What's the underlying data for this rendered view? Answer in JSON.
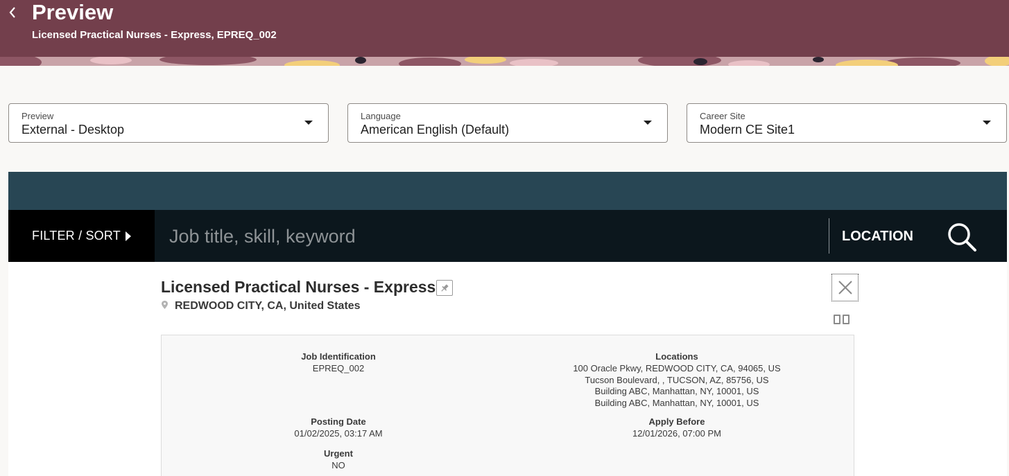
{
  "header": {
    "title": "Preview",
    "subtitle": "Licensed Practical Nurses - Express, EPREQ_002",
    "back_icon": "chevron-left-icon",
    "color": "#733f4c"
  },
  "selectors": [
    {
      "label": "Preview",
      "value": "External - Desktop"
    },
    {
      "label": "Language",
      "value": "American English (Default)"
    },
    {
      "label": "Career Site",
      "value": "Modern CE Site1"
    }
  ],
  "search": {
    "filter_label": "FILTER / SORT",
    "placeholder": "Job title, skill, keyword",
    "location_label": "LOCATION",
    "search_icon": "search-icon"
  },
  "job": {
    "title": "Licensed Practical Nurses - Express",
    "location": "REDWOOD CITY, CA, United States",
    "pin_icon": "pin-icon",
    "close_icon": "close-icon",
    "split_icon": "split-view-icon",
    "details": {
      "job_id_label": "Job Identification",
      "job_id": "EPREQ_002",
      "locations_label": "Locations",
      "locations": [
        "100 Oracle Pkwy, REDWOOD CITY, CA, 94065, US",
        "Tucson Boulevard, , TUCSON, AZ, 85756, US",
        "Building ABC, Manhattan, NY, 10001, US",
        "Building ABC, Manhattan, NY, 10001, US"
      ],
      "posting_date_label": "Posting Date",
      "posting_date": "01/02/2025, 03:17 AM",
      "apply_before_label": "Apply Before",
      "apply_before": "12/01/2026, 07:00 PM",
      "urgent_label": "Urgent",
      "urgent": "NO"
    }
  },
  "colors": {
    "site_band": "#284654",
    "search_bar": "#0c171d",
    "page_bg": "#f9f8f6"
  }
}
